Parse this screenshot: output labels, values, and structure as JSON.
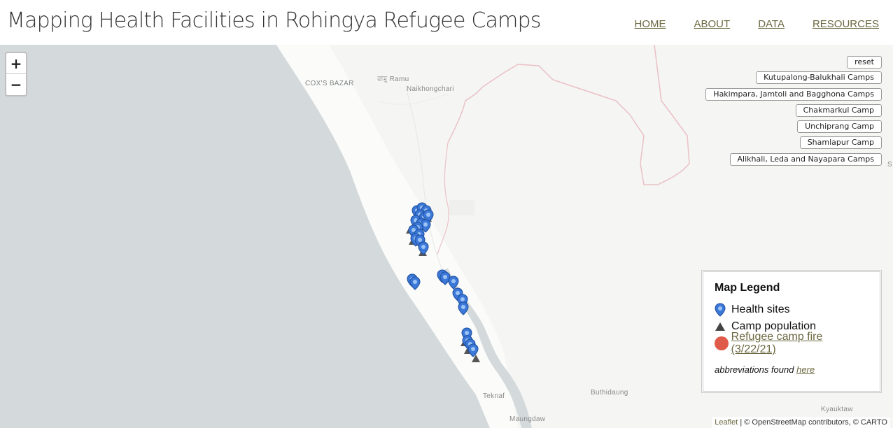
{
  "header": {
    "title": "Mapping Health Facilities in Rohingya Refugee Camps",
    "nav": [
      "HOME",
      "ABOUT",
      "DATA",
      "RESOURCES"
    ]
  },
  "map": {
    "zoom_in_label": "+",
    "zoom_out_label": "−",
    "places": {
      "coxs_bazar": "COX'S BAZAR",
      "ramu": "রামু Ramu",
      "naikhongchari": "Naikhongchari",
      "teknaf": "Teknaf",
      "maungdaw": "Maungdaw",
      "buthidaung": "Buthidaung",
      "kyauktaw": "Kyauktaw",
      "edge_s": "S"
    },
    "colors": {
      "sea": "#d4dadc",
      "land": "#f5f5f3",
      "coast_land": "#fbfbfa",
      "border": "#e8b7bd",
      "health_marker": "#3c78d8",
      "camp_marker": "#555555",
      "fire_marker": "#e05a4a",
      "link": "#6b6840"
    }
  },
  "camp_buttons": [
    "reset",
    "Kutupalong-Balukhali Camps",
    "Hakimpara, Jamtoli and Bagghona Camps",
    "Chakmarkul Camp",
    "Unchiprang Camp",
    "Shamlapur Camp",
    "Alikhali, Leda and Nayapara Camps"
  ],
  "legend": {
    "title": "Map Legend",
    "items": [
      {
        "label": "Health sites",
        "icon": "health-pin-icon"
      },
      {
        "label": "Camp population",
        "icon": "triangle-icon"
      },
      {
        "label": "Refugee camp fire (3/22/21)",
        "icon": "red-circle-icon"
      }
    ],
    "note_prefix": "abbreviations found ",
    "note_link": "here"
  },
  "attribution": {
    "leaflet": "Leaflet",
    "separator": " | ",
    "credits": "© OpenStreetMap contributors, © CARTO"
  }
}
